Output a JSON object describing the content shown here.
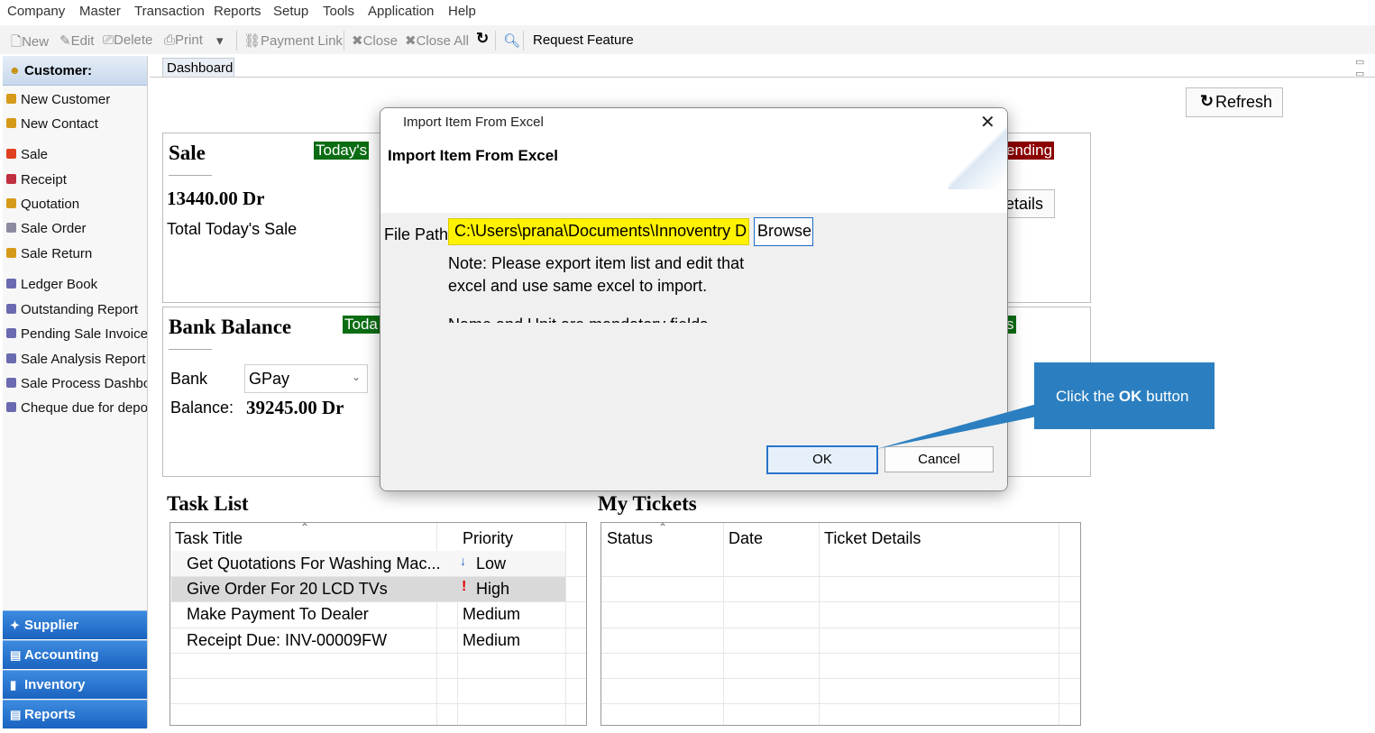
{
  "menu": [
    "Company",
    "Master",
    "Transaction",
    "Reports",
    "Setup",
    "Tools",
    "Application",
    "Help"
  ],
  "toolbar": {
    "new": "New",
    "edit": "Edit",
    "delete": "Delete",
    "print": "Print",
    "payment_link": "Payment Link",
    "close": "Close",
    "close_all": "Close All",
    "request_feature": "Request Feature"
  },
  "sidebar": {
    "header": "Customer:",
    "items": [
      "New Customer",
      "New Contact",
      "Sale",
      "Receipt",
      "Quotation",
      "Sale Order",
      "Sale Return",
      "Ledger Book",
      "Outstanding Report",
      "Pending Sale Invoices",
      "Sale Analysis Report",
      "Sale Process Dashboa",
      "Cheque due for depos"
    ],
    "bottom": [
      "Supplier",
      "Accounting",
      "Inventory",
      "Reports"
    ]
  },
  "tab": {
    "dashboard": "Dashboard"
  },
  "refresh_label": "Refresh",
  "sale_panel": {
    "title": "Sale",
    "badge": "Today's",
    "amount": "13440.00 Dr",
    "caption": "Total Today's Sale",
    "right_badge": "ending",
    "details_btn": "etails"
  },
  "bank_panel": {
    "title": "Bank Balance",
    "badge": "Toda",
    "bank_label": "Bank",
    "bank_value": "GPay",
    "balance_label": "Balance:",
    "balance_value": "39245.00 Dr",
    "right_badge": "s"
  },
  "task_list": {
    "title": "Task List",
    "columns": [
      "Task Title",
      "Priority"
    ],
    "rows": [
      {
        "title": "Get Quotations For Washing Mac...",
        "priority": "Low",
        "marker": "↓"
      },
      {
        "title": "Give Order For 20 LCD TVs",
        "priority": "High",
        "marker": "!"
      },
      {
        "title": "Make Payment To Dealer",
        "priority": "Medium",
        "marker": ""
      },
      {
        "title": "Receipt Due: INV-00009FW",
        "priority": "Medium",
        "marker": ""
      }
    ]
  },
  "my_tickets": {
    "title": "My Tickets",
    "columns": [
      "Status",
      "Date",
      "Ticket Details"
    ]
  },
  "dialog": {
    "window_title": "Import Item From Excel",
    "heading": "Import Item From Excel",
    "file_path_label": "File Path",
    "file_path_value": "C:\\Users\\prana\\Documents\\Innoventry D",
    "browse": "Browse",
    "note_line1": "Note: Please export item list and edit that",
    "note_line2": "excel and use same excel to import.",
    "note_line3": "Name and Unit are mandatory fields",
    "ok": "OK",
    "cancel": "Cancel"
  },
  "callout": {
    "prefix": "Click the ",
    "bold": "OK",
    "suffix": " button"
  }
}
